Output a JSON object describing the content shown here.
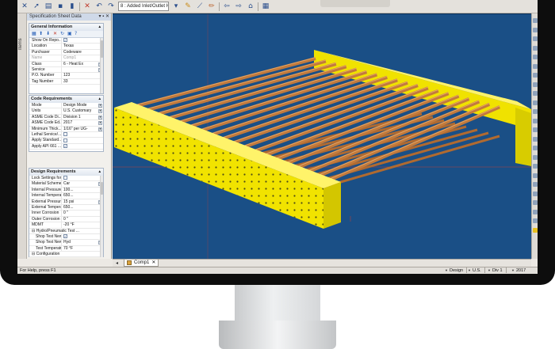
{
  "toolbar": {
    "select_value": "8 : Added Inlet/Outlet He"
  },
  "panel": {
    "title": "Specification Sheet Data",
    "title_buttons": "▾ ▪ ✕",
    "side_tab_label": "Items"
  },
  "general_info": {
    "header": "General Information",
    "rows": [
      {
        "label": "Show On Repo...",
        "value": "✓",
        "kind": "check"
      },
      {
        "label": "Location",
        "value": "Texas"
      },
      {
        "label": "Purchaser",
        "value": "Codeware"
      },
      {
        "label": "Name",
        "value": "Comp1",
        "muted": true
      },
      {
        "label": "Class",
        "value": "6 - Heat Ex",
        "kind": "dropdown"
      },
      {
        "label": "Service",
        "value": "",
        "kind": "dropdown"
      },
      {
        "label": "P.O. Number",
        "value": "123"
      },
      {
        "label": "Tag Number",
        "value": "33"
      }
    ]
  },
  "code_req": {
    "header": "Code Requirements",
    "rows": [
      {
        "label": "Mode",
        "value": "Design Mode",
        "kind": "dropdown"
      },
      {
        "label": "Units",
        "value": "U.S. Customary",
        "kind": "dropdown"
      },
      {
        "label": "ASME Code Di...",
        "value": "Division 1",
        "kind": "dropdown"
      },
      {
        "label": "ASME Code Ed...",
        "value": "2017",
        "kind": "dropdown"
      },
      {
        "label": "Minimum Thick...",
        "value": "1/16\" per UG-",
        "kind": "dropdown"
      },
      {
        "label": "Lethal Service/...",
        "value": "",
        "kind": "check"
      },
      {
        "label": "Apply Standard...",
        "value": "",
        "kind": "check"
      },
      {
        "label": "Apply API 661 ...",
        "value": "✓",
        "kind": "check"
      }
    ]
  },
  "design_req": {
    "header": "Design Requirements",
    "rows": [
      {
        "label": "Lock Settings for Indivi...",
        "value": "",
        "kind": "check"
      },
      {
        "label": "Material Scheme",
        "value": "Car",
        "kind": "dropdown"
      },
      {
        "label": "Internal Pressure",
        "value": "100..."
      },
      {
        "label": "Internal Temperature",
        "value": "650..."
      },
      {
        "label": "External Pressure",
        "value": "15 psi",
        "kind": "dropdown"
      },
      {
        "label": "External Temperature",
        "value": "650..."
      },
      {
        "label": "Inner Corrosion",
        "value": "0 \""
      },
      {
        "label": "Outer Corrosion",
        "value": "0 \""
      },
      {
        "label": "MDMT",
        "value": "-20 °F"
      },
      {
        "label": "⊟ Hydro/Pneumatic Test ...",
        "value": "",
        "kind": "group"
      },
      {
        "label": "Shop Test New",
        "value": "✓",
        "kind": "check",
        "indent": true
      },
      {
        "label": "Shop Test New Te...",
        "value": "Hyd",
        "kind": "dropdown",
        "indent": true
      },
      {
        "label": "Test Temperature",
        "value": "70 °F",
        "indent": true
      },
      {
        "label": "⊟ Configuration",
        "value": "",
        "kind": "group"
      }
    ]
  },
  "doctabs": {
    "nav": "◂",
    "active_label": "Comp1",
    "close": "✕"
  },
  "status": {
    "help": "For Help, press F1",
    "items": [
      "Design",
      "U.S.",
      "Div 1",
      "2017"
    ]
  },
  "colors": {
    "viewport_bg": "#1a4f86",
    "header_box": "#f5ef00",
    "tube": "#c27a3c"
  }
}
